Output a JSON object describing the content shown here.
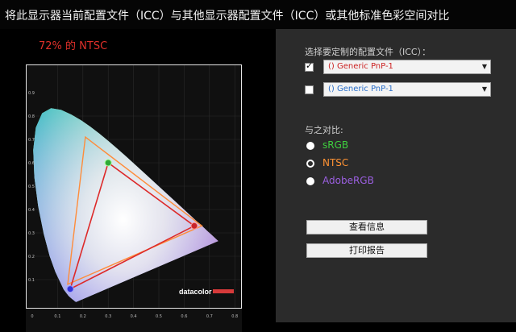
{
  "window": {
    "title": "将此显示器当前配置文件（ICC）与其他显示器配置文件（ICC）或其他标准色彩空间对比"
  },
  "gamut_result": "72% 的 NTSC",
  "profile_section": {
    "label": "选择要定制的配置文件（ICC）：",
    "profiles": [
      {
        "checked": true,
        "check_mark": "✓",
        "value": "() Generic PnP-1",
        "color": "#cc2222"
      },
      {
        "checked": false,
        "check_mark": "",
        "value": "() Generic PnP-1",
        "color": "#2a6fc9"
      }
    ]
  },
  "compare_section": {
    "label": "与之对比:",
    "options": [
      {
        "label": "sRGB",
        "color": "#3ecf3e",
        "selected": true
      },
      {
        "label": "NTSC",
        "color": "#ff9233",
        "selected": false
      },
      {
        "label": "AdobeRGB",
        "color": "#9b5fe0",
        "selected": true
      }
    ]
  },
  "buttons": {
    "info": "查看信息",
    "report": "打印报告"
  },
  "diagram": {
    "brand": "datacolor",
    "x_ticks": [
      "0",
      "0.1",
      "0.2",
      "0.3",
      "0.4",
      "0.5",
      "0.6",
      "0.7",
      "0.8"
    ],
    "y_ticks": [
      "0.9",
      "0.8",
      "0.7",
      "0.6",
      "0.5",
      "0.4",
      "0.3",
      "0.2",
      "0.1"
    ],
    "gamuts": {
      "display": [
        [
          0.64,
          0.33
        ],
        [
          0.3,
          0.6
        ],
        [
          0.15,
          0.06
        ]
      ],
      "ntsc": [
        [
          0.67,
          0.33
        ],
        [
          0.21,
          0.71
        ],
        [
          0.14,
          0.08
        ]
      ]
    },
    "colors": {
      "display_triangle": "#dd2a2a",
      "ntsc_triangle": "#ff8c3a"
    }
  }
}
